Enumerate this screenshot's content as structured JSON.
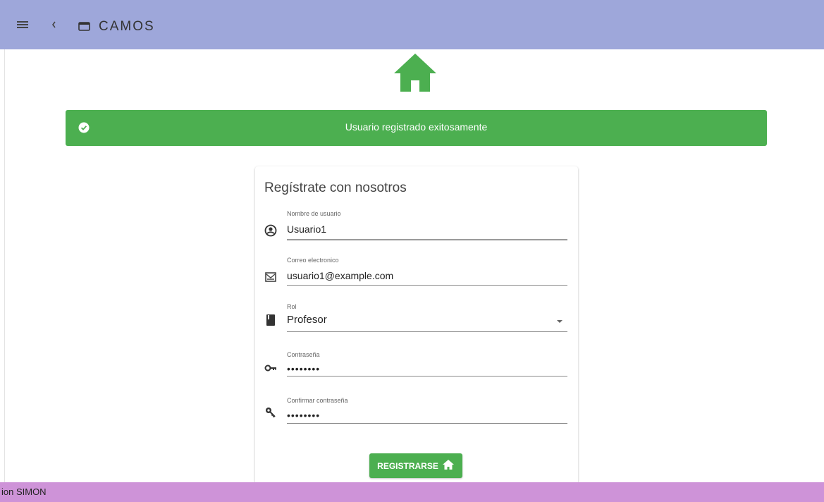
{
  "appbar": {
    "title": "CAMOS",
    "menu_icon": "hamburger-menu-icon",
    "back_icon": "chevron-left-icon",
    "window_icon": "window-icon",
    "color": "#9ea7da"
  },
  "logo": {
    "icon": "home-icon",
    "color": "#4caf50"
  },
  "alert": {
    "message": "Usuario registrado exitosamente",
    "icon": "check-circle-icon",
    "color": "#4caf50"
  },
  "form": {
    "title": "Regístrate con nosotros",
    "fields": [
      {
        "label": "Nombre de usuario",
        "value": "Usuario1",
        "icon": "account-circle-icon"
      },
      {
        "label": "Correo electronico",
        "value": "usuario1@example.com",
        "icon": "email-icon"
      },
      {
        "label": "Rol",
        "value": "Profesor",
        "icon": "book-icon"
      },
      {
        "label": "Contraseña",
        "value": "••••••••",
        "icon": "key-icon"
      },
      {
        "label": "Confirmar contraseña",
        "value": "••••••••",
        "icon": "key-search-icon"
      }
    ],
    "submit_label": "REGISTRARSE",
    "submit_icon": "home-icon"
  },
  "footer": {
    "text": "ion SIMON",
    "color": "#ce93d8"
  }
}
